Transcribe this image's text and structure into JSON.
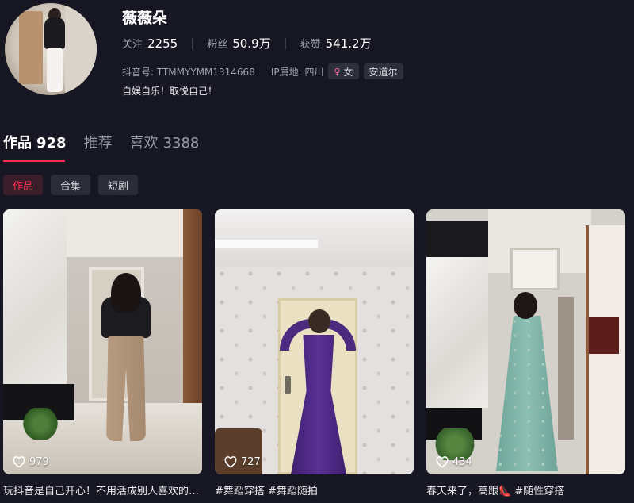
{
  "profile": {
    "name": "薇薇朵",
    "stats": [
      {
        "label": "关注",
        "value": "2255"
      },
      {
        "label": "粉丝",
        "value": "50.9万"
      },
      {
        "label": "获赞",
        "value": "541.2万"
      }
    ],
    "douyin_id": "抖音号: TTMMYYMM1314668",
    "ip_location": "IP属地: 四川",
    "gender_tag": "女",
    "location_tag": "安道尔",
    "bio": "自娱自乐！取悦自己！"
  },
  "tabs": [
    {
      "label": "作品",
      "count": "928",
      "active": true
    },
    {
      "label": "推荐",
      "count": ""
    },
    {
      "label": "喜欢",
      "count": "3388"
    }
  ],
  "subtabs": [
    "作品",
    "合集",
    "短剧"
  ],
  "videos": [
    {
      "likes": "979",
      "caption": "玩抖音是自己开心！不用活成别人喜欢的样子"
    },
    {
      "likes": "727",
      "caption": "#舞蹈穿搭 #舞蹈随拍"
    },
    {
      "likes": "434",
      "caption": "春天来了，高跟👠 #随性穿搭"
    }
  ],
  "colors": {
    "background": "#161722",
    "accent": "#fe2c55",
    "muted_text": "#9fa2ad",
    "female_icon": "#ff6b9e"
  }
}
